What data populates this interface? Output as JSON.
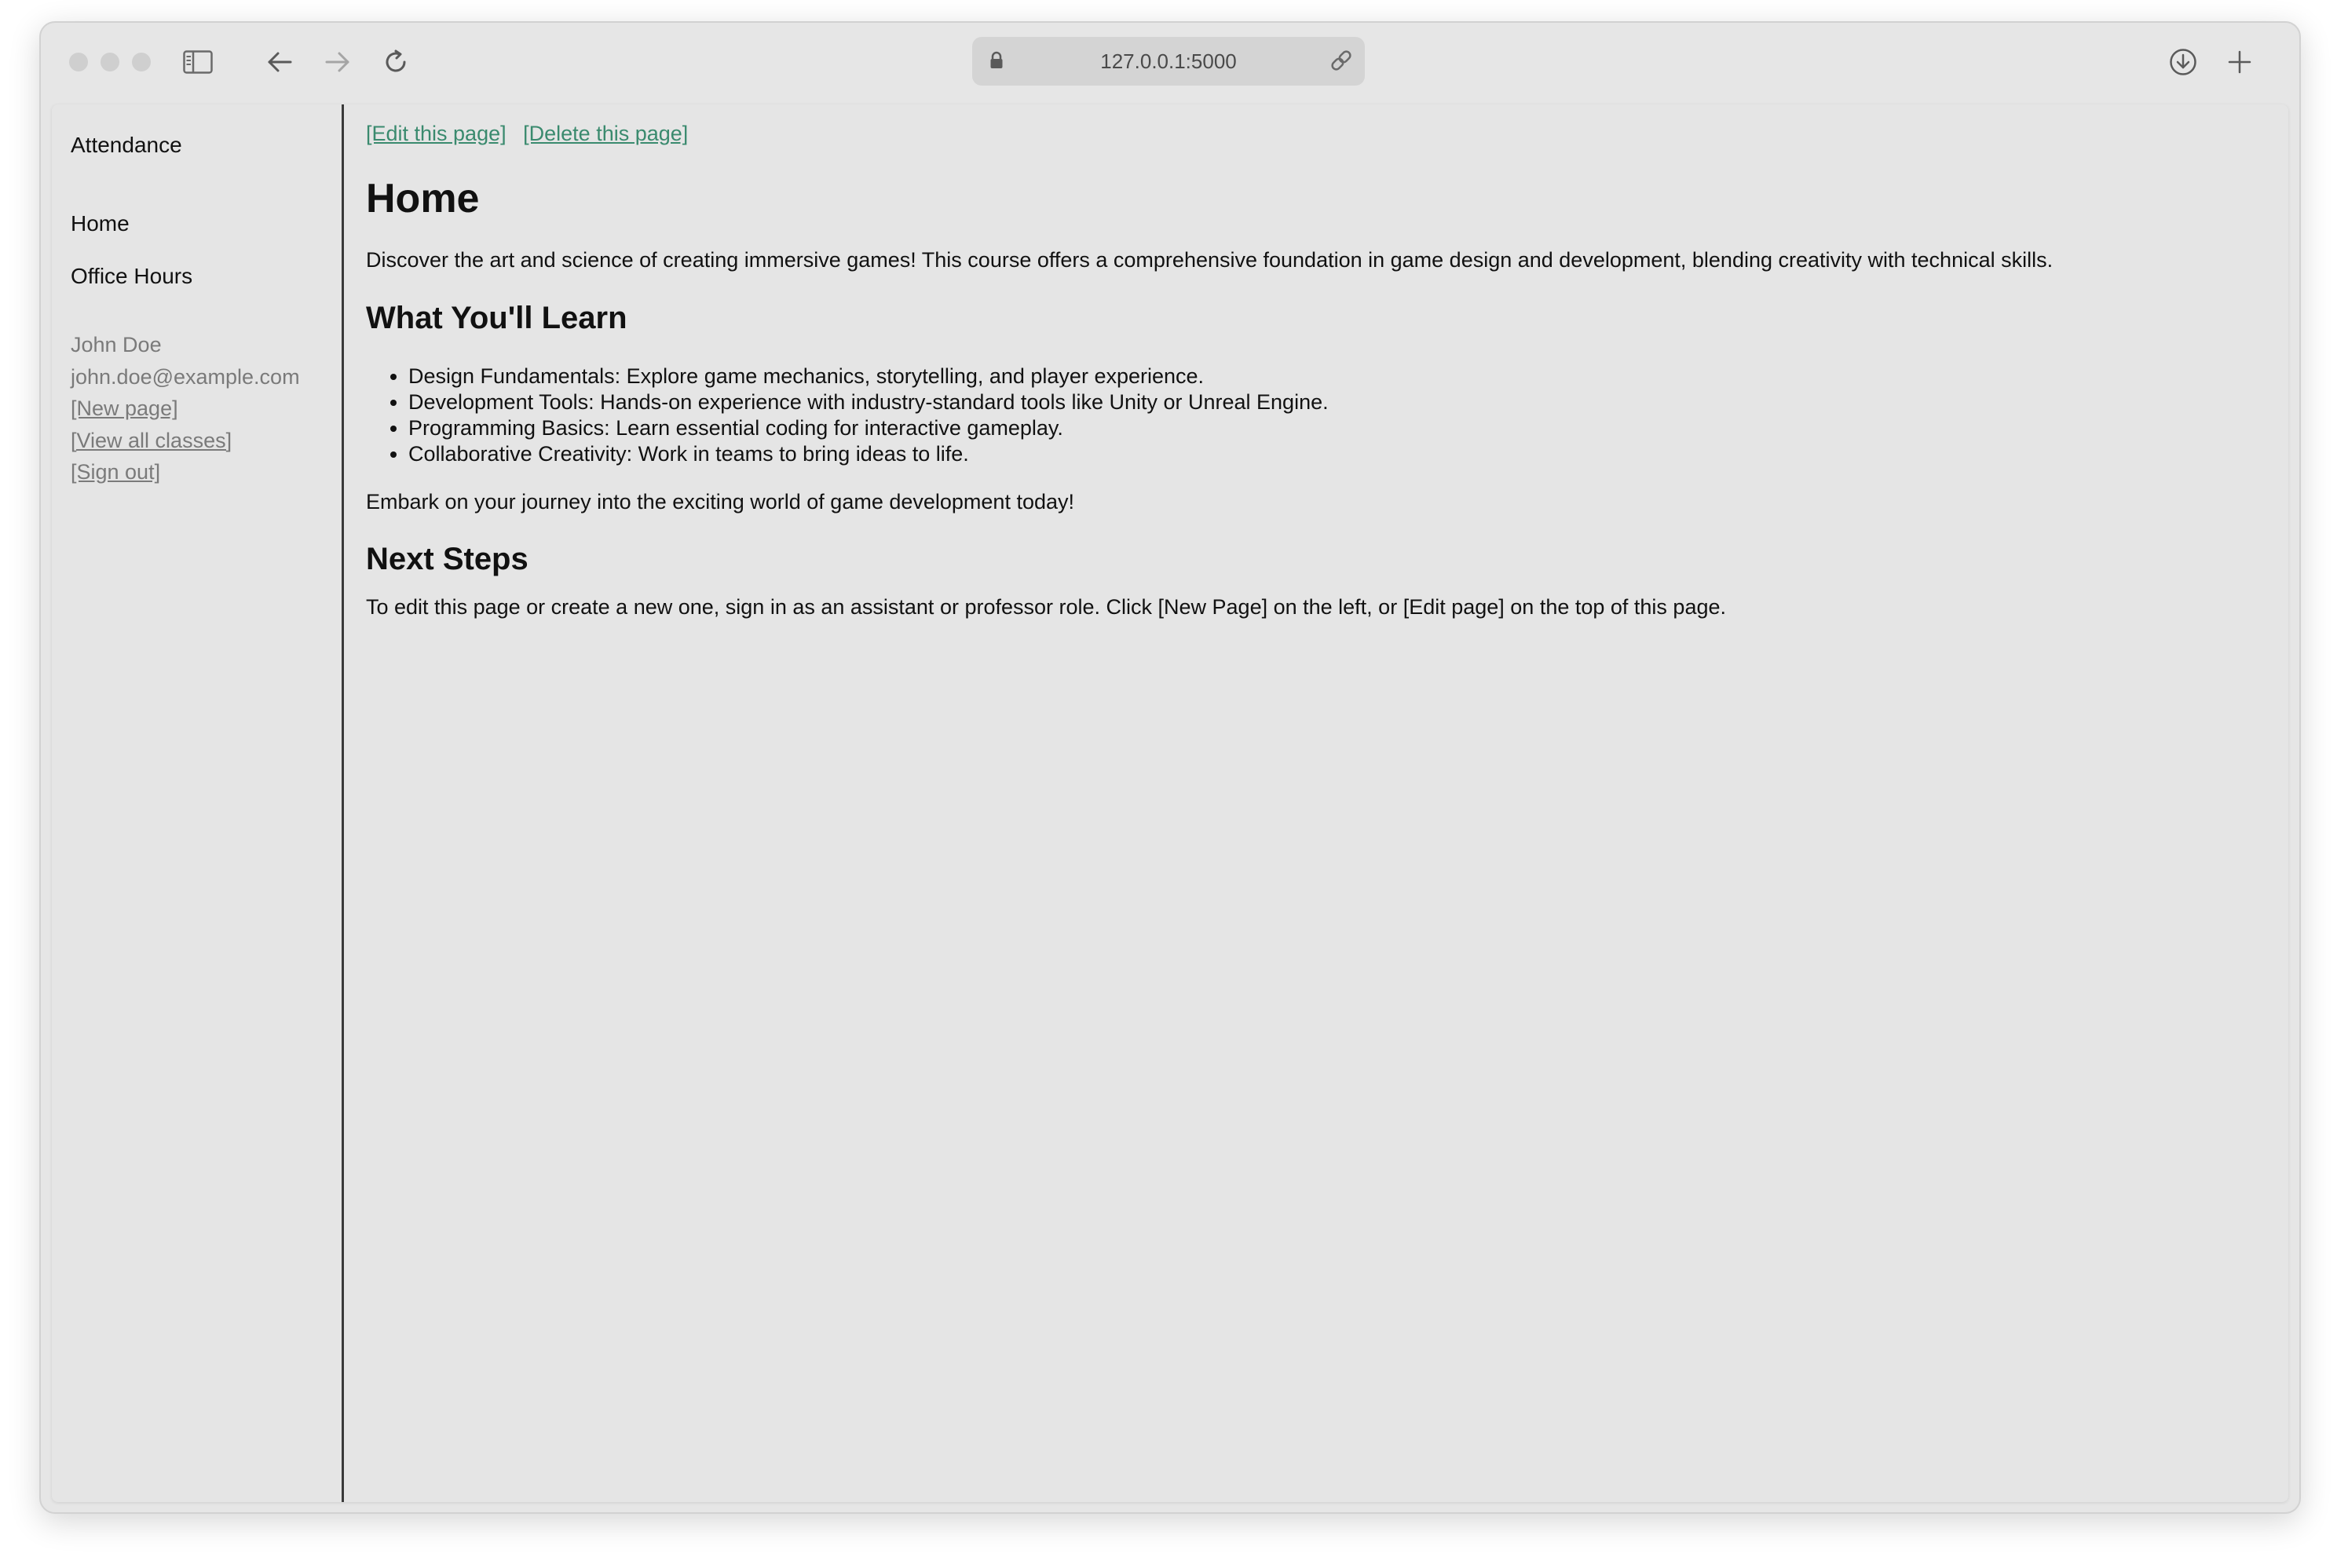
{
  "browser": {
    "url": "127.0.0.1:5000"
  },
  "sidebar": {
    "title": "Attendance",
    "nav": [
      {
        "label": "Home"
      },
      {
        "label": "Office Hours"
      }
    ],
    "user": {
      "name": "John Doe",
      "email": "john.doe@example.com",
      "links": [
        "[New page]",
        "[View all classes]",
        "[Sign out]"
      ]
    }
  },
  "main": {
    "actions": [
      "[Edit this page]",
      "[Delete this page]"
    ],
    "title": "Home",
    "intro": "Discover the art and science of creating immersive games! This course offers a comprehensive foundation in game design and development, blending creativity with technical skills.",
    "learn_heading": "What You'll Learn",
    "learn_items": [
      "Design Fundamentals: Explore game mechanics, storytelling, and player experience.",
      "Development Tools: Hands-on experience with industry-standard tools like Unity or Unreal Engine.",
      "Programming Basics: Learn essential coding for interactive gameplay.",
      "Collaborative Creativity: Work in teams to bring ideas to life."
    ],
    "outro": "Embark on your journey into the exciting world of game development today!",
    "next_heading": "Next Steps",
    "next_text": "To edit this page or create a new one, sign in as an assistant or professor role. Click [New Page] on the left, or [Edit page] on the top of this page."
  },
  "colors": {
    "link": "#3a8a6e",
    "muted": "#7a7a7a",
    "background": "#e5e5e5"
  }
}
